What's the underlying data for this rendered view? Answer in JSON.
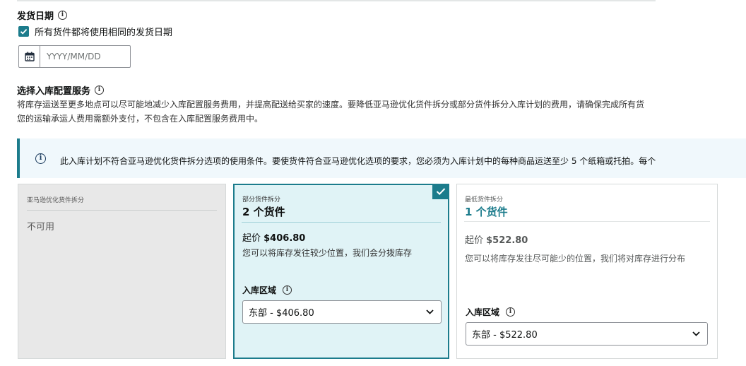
{
  "ship_date": {
    "title": "发货日期",
    "same_date_label": "所有货件都将使用相同的发货日期",
    "same_date_checked": true,
    "date_placeholder": "YYYY/MM/DD",
    "date_value": ""
  },
  "placement_service": {
    "title": "选择入库配置服务",
    "desc_line1": "将库存运送至更多地点可以尽可能地减少入库配置服务费用，并提高配送给买家的速度。要降低亚马逊优化货件拆分或部分货件拆分入库计划的费用，请确保完成所有货",
    "desc_line2": "您的运输承运人费用需额外支付，不包含在入库配置服务费用中。"
  },
  "alert": {
    "text": "此入库计划不符合亚马逊优化货件拆分选项的使用条件。要使货件符合亚马逊优化选项的要求，您必须为入库计划中的每种商品运送至少 5 个纸箱或托拍。每个"
  },
  "cards": [
    {
      "kicker": "亚马逊优化货件拆分",
      "unavailable": "不可用"
    },
    {
      "kicker": "部分货件拆分",
      "count": "2 个货件",
      "price_prefix": "起价 ",
      "price": "$406.80",
      "desc": "您可以将库存发往较少位置，我们会分拨库存",
      "region_label": "入库区域",
      "region_value": "东部 - $406.80",
      "selected": true
    },
    {
      "kicker": "最低货件拆分",
      "count": "1 个货件",
      "price_prefix": "起价 ",
      "price": "$522.80",
      "desc": "您可以将库存发往尽可能少的位置，我们将对库存进行分布",
      "region_label": "入库区域",
      "region_value": "东部 - $522.80",
      "selected": false
    }
  ],
  "colors": {
    "accent": "#1c7c8c",
    "selected_bg": "#e0f3f6",
    "disabled_bg": "#e8e8e8",
    "alert_bg": "#f0f8fc"
  },
  "icons": {
    "info": "info-circle-icon",
    "calendar": "calendar-icon",
    "check": "checkmark-icon",
    "chevron": "chevron-down-icon"
  }
}
